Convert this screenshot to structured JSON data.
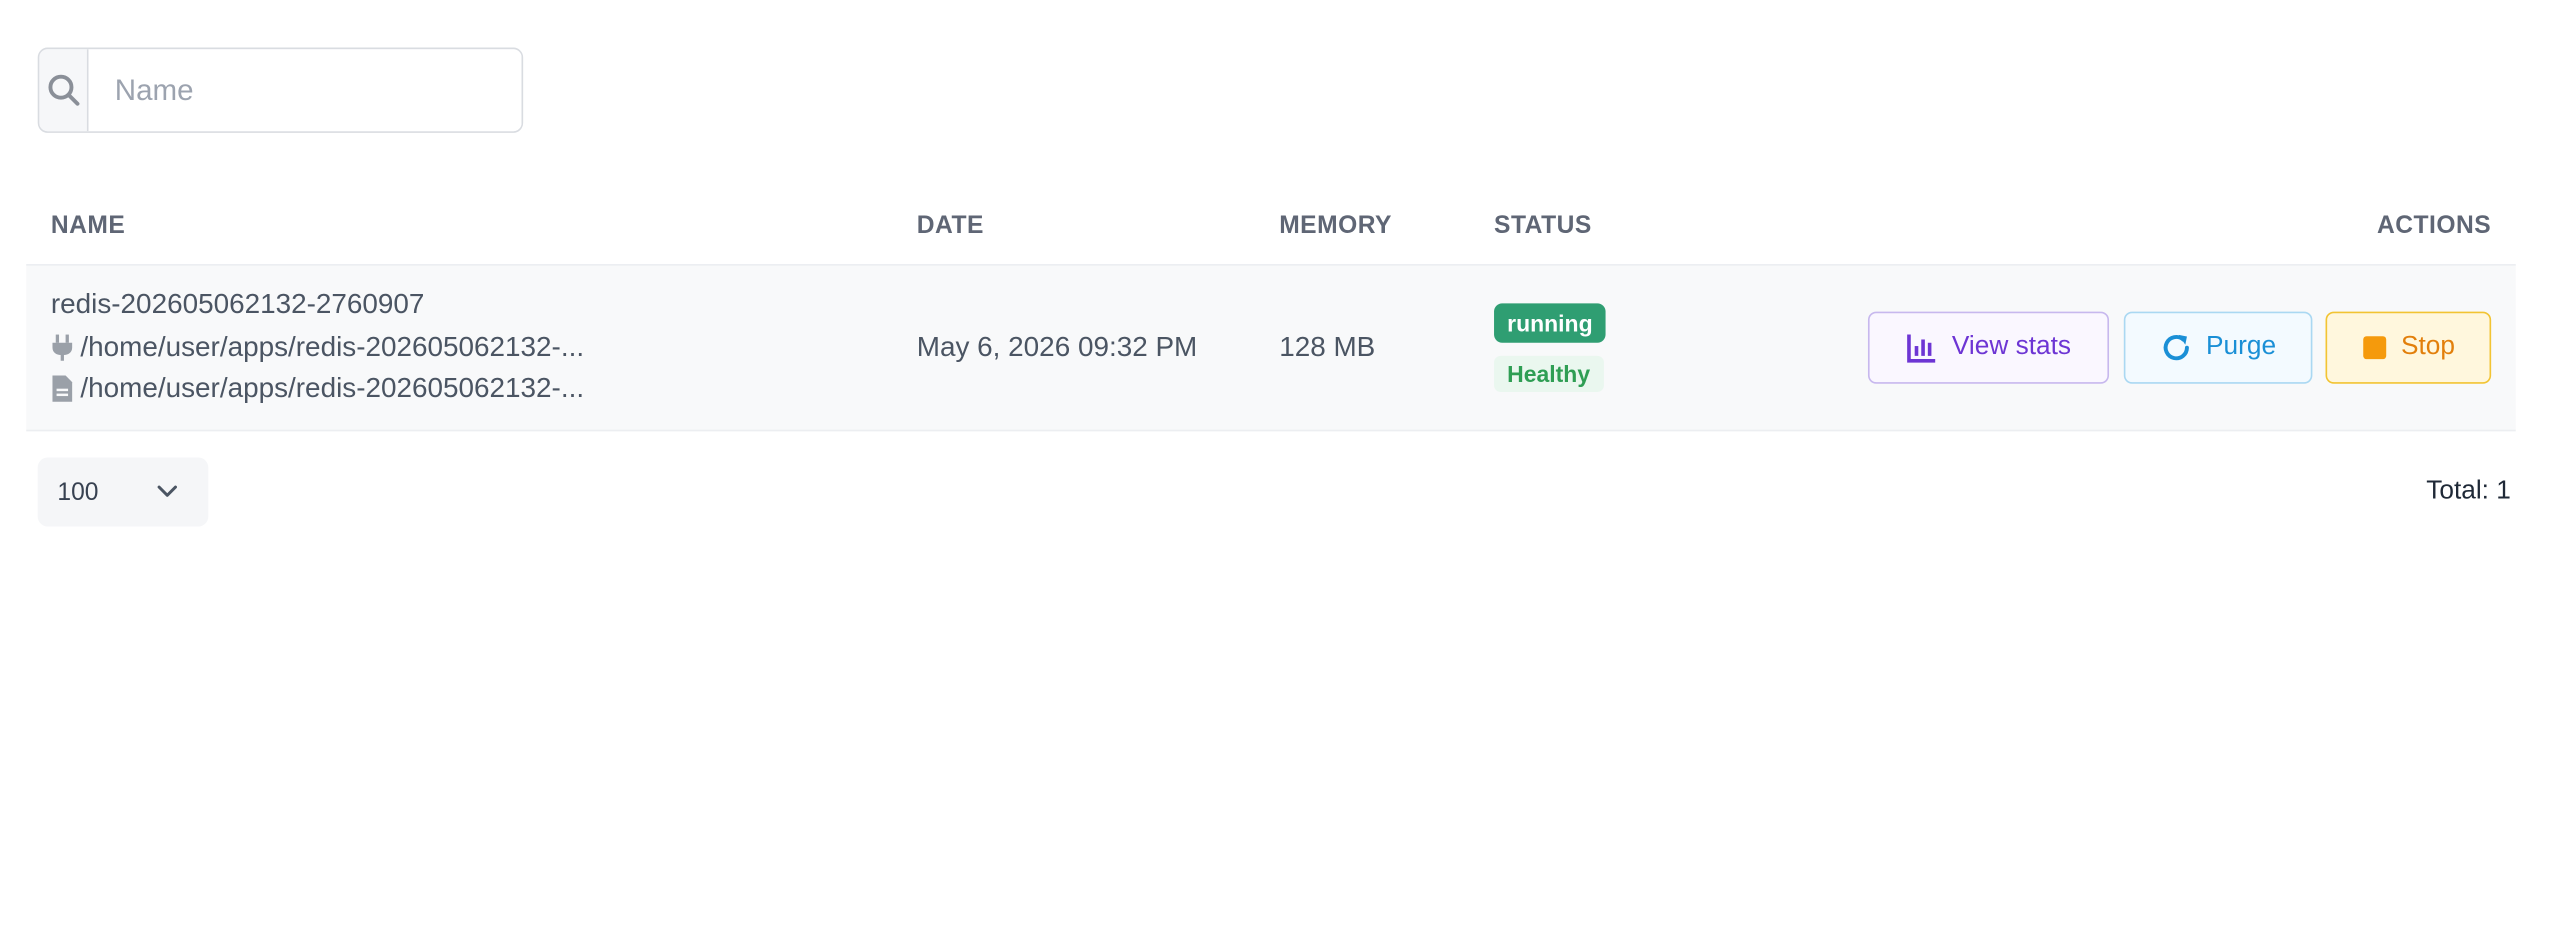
{
  "search": {
    "placeholder": "Name"
  },
  "table": {
    "headers": {
      "name": "NAME",
      "date": "DATE",
      "memory": "MEMORY",
      "status": "STATUS",
      "actions": "ACTIONS"
    },
    "rows": [
      {
        "name": "redis-202605062132-2760907",
        "socket_path": "/home/user/apps/redis-202605062132-...",
        "config_path": "/home/user/apps/redis-202605062132-...",
        "date": "May 6, 2026 09:32 PM",
        "memory": "128 MB",
        "status": "running",
        "health": "Healthy",
        "actions": {
          "stats": "View stats",
          "purge": "Purge",
          "stop": "Stop"
        }
      }
    ]
  },
  "footer": {
    "page_size": "100",
    "total": "Total: 1"
  },
  "colors": {
    "running": "#2f9e72",
    "healthy": "#2f9e54",
    "stats": "#6d35d4",
    "purge": "#1a8fd6",
    "stop": "#e27f0b"
  },
  "icons": {
    "search": "search-icon",
    "plug": "plug-icon",
    "file": "file-icon",
    "stats": "bar-chart-icon",
    "purge": "refresh-icon",
    "stop": "stop-icon",
    "chevron": "chevron-down-icon"
  }
}
